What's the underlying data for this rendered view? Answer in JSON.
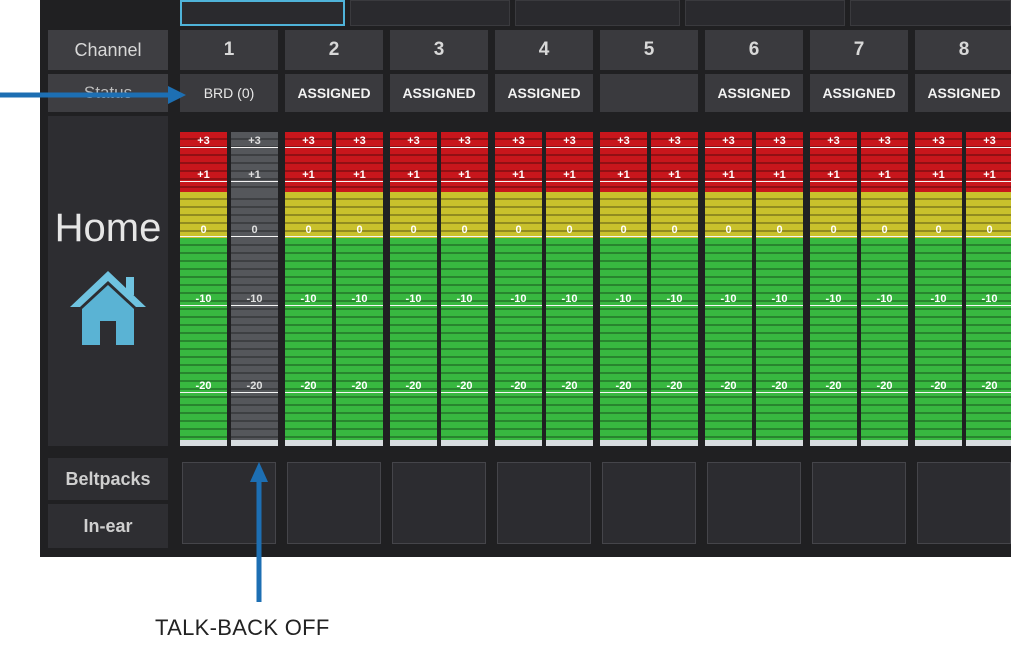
{
  "sidebar": {
    "channel_label": "Channel",
    "status_label": "Status",
    "home_label": "Home",
    "home_icon": "house-icon",
    "beltpacks_label": "Beltpacks",
    "inear_label": "In-ear"
  },
  "channels": [
    {
      "number": "1",
      "status": "BRD (0)"
    },
    {
      "number": "2",
      "status": "ASSIGNED"
    },
    {
      "number": "3",
      "status": "ASSIGNED"
    },
    {
      "number": "4",
      "status": "ASSIGNED"
    },
    {
      "number": "5",
      "status": ""
    },
    {
      "number": "6",
      "status": "ASSIGNED"
    },
    {
      "number": "7",
      "status": "ASSIGNED"
    },
    {
      "number": "8",
      "status": "ASSIGNED"
    }
  ],
  "meter_scale": [
    "+3",
    "+1",
    "0",
    "-10",
    "-20"
  ],
  "colors": {
    "red": "#c8161c",
    "yellow": "#c9c12c",
    "green": "#38b840",
    "inactive": "#55575b",
    "arrow": "#1d6fb3"
  },
  "annotation": {
    "talkback_label": "TALK-BACK OFF"
  }
}
